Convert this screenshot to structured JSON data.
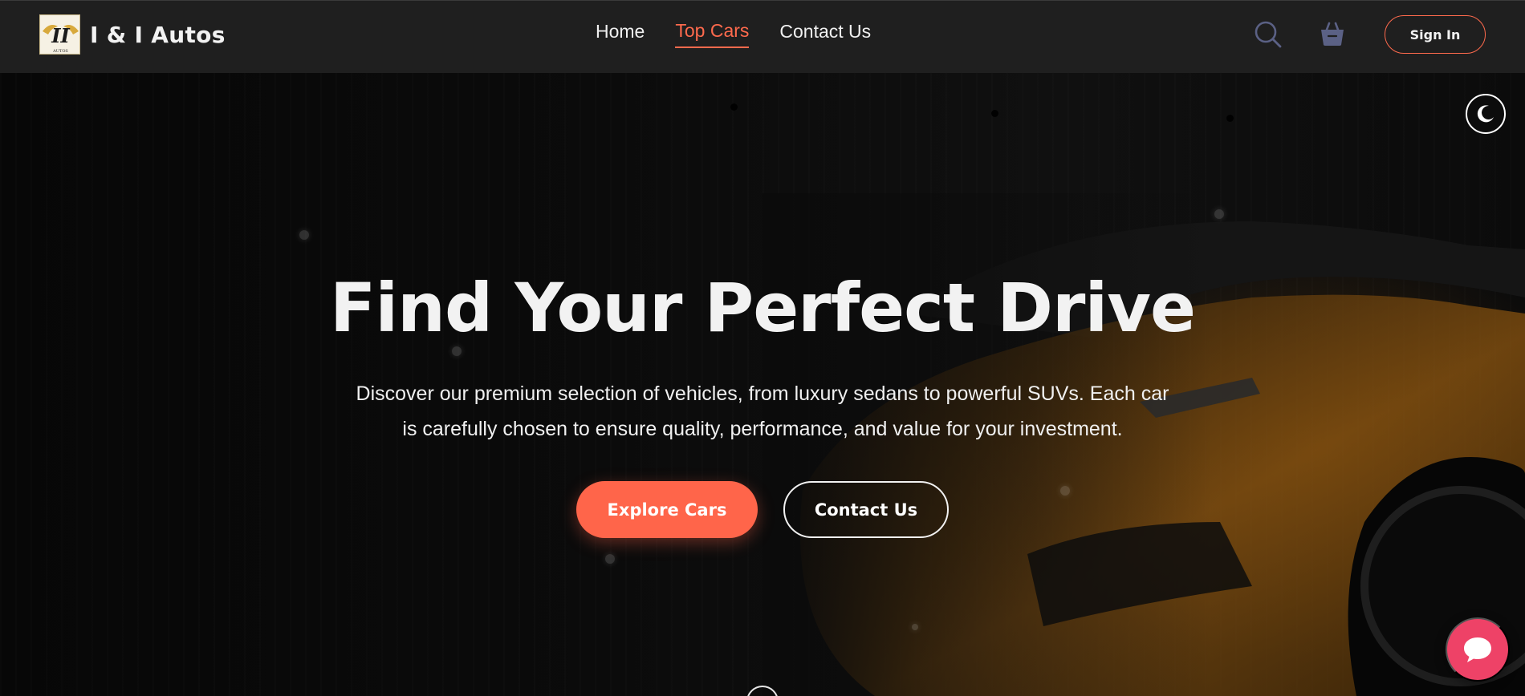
{
  "brand": {
    "name": "I & I Autos",
    "logo_icon": "winged-ii-logo-icon",
    "logo_text": "II",
    "logo_subtext": "AUTOS"
  },
  "nav": {
    "items": [
      {
        "label": "Home",
        "active": false
      },
      {
        "label": "Top Cars",
        "active": true
      },
      {
        "label": "Contact Us",
        "active": false
      }
    ],
    "search_icon": "search-icon",
    "cart_icon": "basket-icon",
    "signin_label": "Sign In"
  },
  "hero": {
    "title": "Find Your Perfect Drive",
    "subtitle": "Discover our premium selection of vehicles, from luxury sedans to powerful SUVs. Each car is carefully chosen to ensure quality, performance, and value for your investment.",
    "primary_cta": "Explore Cars",
    "secondary_cta": "Contact Us",
    "background": "dark-sports-car-image"
  },
  "theme_toggle_icon": "moon-icon",
  "chat_icon": "chat-bubble-icon",
  "colors": {
    "accent": "#ff654a",
    "nav_bg": "#1f1f1f",
    "chat": "#ee4267",
    "icon_muted": "#5b6185"
  }
}
